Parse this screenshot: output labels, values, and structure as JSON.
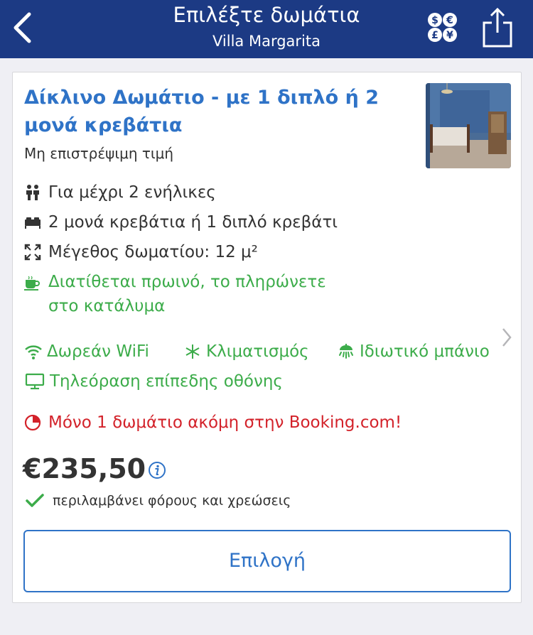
{
  "header": {
    "title": "Επιλέξτε δωμάτια",
    "subtitle": "Villa Margarita",
    "back_icon": "chevron-left-icon",
    "currency_icon": "currency-icon",
    "share_icon": "share-icon"
  },
  "room": {
    "title": "Δίκλινο Δωμάτιο - με 1 διπλό ή 2 μονά κρεβάτια",
    "policy": "Μη επιστρέψιμη τιμή",
    "features": [
      {
        "icon": "guests-icon",
        "text": "Για μέχρι 2 ενήλικες"
      },
      {
        "icon": "bed-icon",
        "text": "2 μονά κρεβάτια ή 1 διπλό κρεβάτι"
      },
      {
        "icon": "room-size-icon",
        "text": "Μέγεθος δωματίου: 12 μ²"
      }
    ],
    "breakfast": {
      "icon": "coffee-cup-icon",
      "line1": "Διατίθεται πρωινό, το πληρώνετε",
      "line2": "στο κατάλυμα"
    },
    "amenities": [
      {
        "icon": "wifi-icon",
        "text": "Δωρεάν WiFi"
      },
      {
        "icon": "snowflake-icon",
        "text": "Κλιματισμός"
      },
      {
        "icon": "shower-icon",
        "text": "Ιδιωτικό μπάνιο"
      },
      {
        "icon": "tv-icon",
        "text": "Τηλεόραση επίπεδης οθόνης"
      }
    ],
    "scarcity": "Μόνο 1 δωμάτιο ακόμη στην Booking.com!",
    "price": "€235,50",
    "taxes_note": "περιλαμβάνει φόρους και χρεώσεις",
    "select_label": "Επιλογή"
  },
  "colors": {
    "header_bg": "#1c3a84",
    "link_blue": "#2f73c7",
    "green": "#3cac4a",
    "red": "#d3222a"
  }
}
